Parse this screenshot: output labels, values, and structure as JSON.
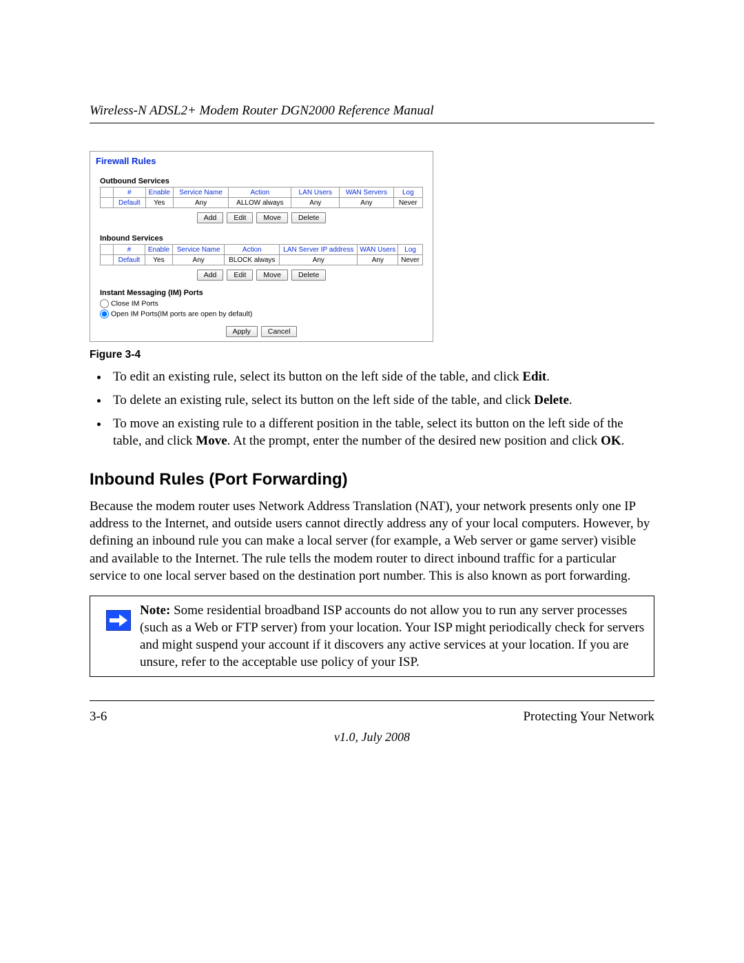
{
  "running_head": "Wireless-N ADSL2+ Modem Router DGN2000 Reference Manual",
  "figure": {
    "title": "Firewall Rules",
    "section_outbound": "Outbound Services",
    "section_inbound": "Inbound Services",
    "outbound_headers": {
      "c1": "",
      "c2": "#",
      "c3": "Enable",
      "c4": "Service Name",
      "c5": "Action",
      "c6": "LAN Users",
      "c7": "WAN Servers",
      "c8": "Log"
    },
    "outbound_row": {
      "c1": "",
      "c2": "Default",
      "c3": "Yes",
      "c4": "Any",
      "c5": "ALLOW always",
      "c6": "Any",
      "c7": "Any",
      "c8": "Never"
    },
    "inbound_headers": {
      "c1": "",
      "c2": "#",
      "c3": "Enable",
      "c4": "Service Name",
      "c5": "Action",
      "c6": "LAN Server IP address",
      "c7": "WAN Users",
      "c8": "Log"
    },
    "inbound_row": {
      "c1": "",
      "c2": "Default",
      "c3": "Yes",
      "c4": "Any",
      "c5": "BLOCK always",
      "c6": "Any",
      "c7": "Any",
      "c8": "Never"
    },
    "btn_add": "Add",
    "btn_edit": "Edit",
    "btn_move": "Move",
    "btn_delete": "Delete",
    "btn_apply": "Apply",
    "btn_cancel": "Cancel",
    "im_title": "Instant Messaging (IM) Ports",
    "im_close": "Close IM Ports",
    "im_open": "Open IM Ports(IM ports are open by default)"
  },
  "figure_caption": "Figure 3-4",
  "bullets": {
    "b1a": "To edit an existing rule, select its button on the left side of the table, and click ",
    "b1b": "Edit",
    "b1c": ".",
    "b2a": "To delete an existing rule, select its button on the left side of the table, and click ",
    "b2b": "Delete",
    "b2c": ".",
    "b3a": "To move an existing rule to a different position in the table, select its button on the left side of the table, and click ",
    "b3b": "Move",
    "b3c": ". At the prompt, enter the number of the desired new position and click ",
    "b3d": "OK",
    "b3e": "."
  },
  "heading": "Inbound Rules (Port Forwarding)",
  "paragraph": "Because the modem router uses Network Address Translation (NAT), your network presents only one IP address to the Internet, and outside users cannot directly address any of your local computers. However, by defining an inbound rule you can make a local server (for example, a Web server or game server) visible and available to the Internet. The rule tells the modem router to direct inbound traffic for a particular service to one local server based on the destination port number. This is also known as port forwarding.",
  "note_label": "Note:",
  "note_body": " Some residential broadband ISP accounts do not allow you to run any server processes (such as a Web or FTP server) from your location. Your ISP might periodically check for servers and might suspend your account if it discovers any active services at your location. If you are unsure, refer to the acceptable use policy of your ISP.",
  "footer_left": "3-6",
  "footer_right": "Protecting Your Network",
  "version": "v1.0, July 2008"
}
